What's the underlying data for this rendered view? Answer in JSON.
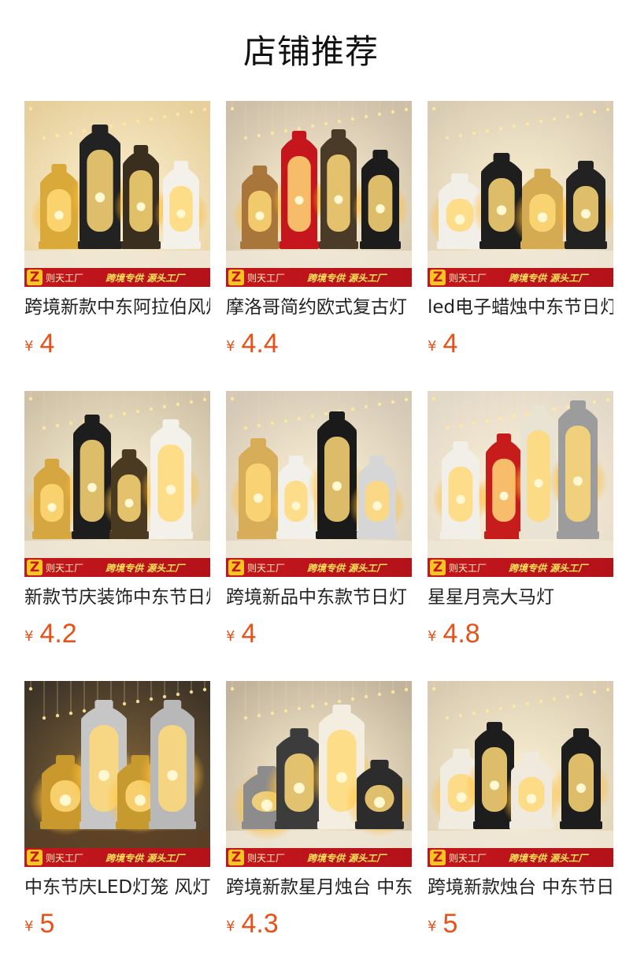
{
  "page": {
    "title": "店铺推荐"
  },
  "banner": {
    "logo": "Z",
    "brand": "则天工厂",
    "slogan": "跨境专供 源头工厂"
  },
  "currency": "¥",
  "products": [
    {
      "name": "跨境新款中东阿拉伯风灯",
      "price": "4",
      "thumb": "lanterns-gold-black-white",
      "theme": "#e6cf9c"
    },
    {
      "name": "摩洛哥简约欧式复古灯",
      "price": "4.4",
      "thumb": "lanterns-red-bronze-black",
      "theme": "#cdbfa8"
    },
    {
      "name": "led电子蜡烛中东节日灯",
      "price": "4",
      "thumb": "round-lanterns-white-black",
      "theme": "#d9ccb4"
    },
    {
      "name": "新款节庆装饰中东节日灯",
      "price": "4.2",
      "thumb": "lanterns-gold-black-white-silver",
      "theme": "#cfc2a8"
    },
    {
      "name": "跨境新品中东款节日灯",
      "price": "4",
      "thumb": "lanterns-on-marble",
      "theme": "#d4c8b6"
    },
    {
      "name": "星星月亮大马灯",
      "price": "4.8",
      "thumb": "oil-lamps-white-red-silver",
      "theme": "#e2d8c8"
    },
    {
      "name": "中东节庆LED灯笼 风灯",
      "price": "5",
      "thumb": "silver-gold-oil-lamps",
      "theme": "#3e3428"
    },
    {
      "name": "跨境新款星月烛台 中东",
      "price": "4.3",
      "thumb": "crescent-moon-candle-holders",
      "theme": "#c2b49c"
    },
    {
      "name": "跨境新款烛台 中东节日",
      "price": "5",
      "thumb": "white-black-lanterns-shelf",
      "theme": "#d8cbb2"
    }
  ]
}
